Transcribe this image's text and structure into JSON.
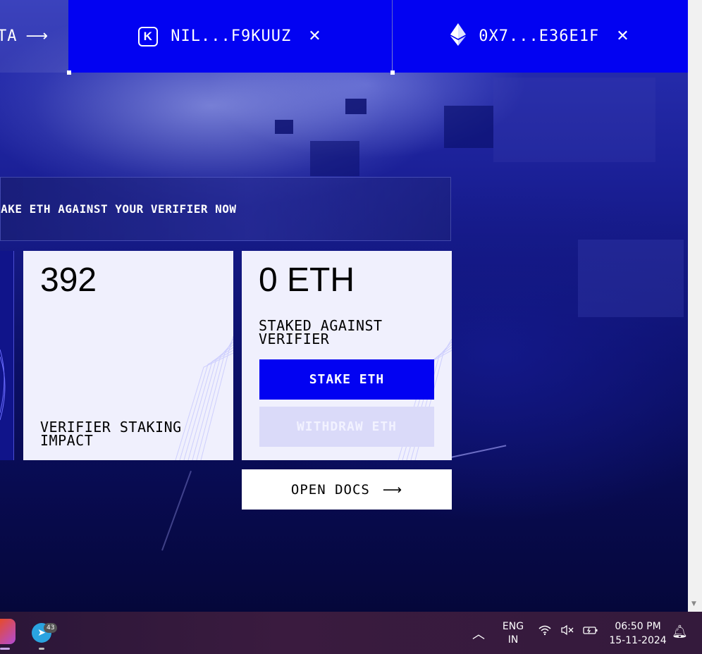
{
  "header": {
    "left_tab_label": "TA",
    "tab1": {
      "label": "NIL...F9KUUZ",
      "icon": "k-wallet-icon"
    },
    "tab2": {
      "label": "0X7...E36E1F",
      "icon": "ethereum-icon"
    }
  },
  "banner": {
    "text": "TAKE ETH AGAINST YOUR VERIFIER NOW"
  },
  "impact_card": {
    "value": "392",
    "label": "VERIFIER STAKING IMPACT"
  },
  "staked_card": {
    "value": "0 ETH",
    "label": "STAKED AGAINST VERIFIER",
    "stake_button": "STAKE ETH",
    "withdraw_button": "WITHDRAW ETH"
  },
  "docs_button": {
    "label": "OPEN DOCS"
  },
  "taskbar": {
    "telegram_badge": "43",
    "lang_line1": "ENG",
    "lang_line2": "IN",
    "time": "06:50 PM",
    "date": "15-11-2024"
  },
  "colors": {
    "accent": "#0202f2",
    "card_bg": "#f0f0fd",
    "disabled_btn": "#dadaf9"
  }
}
